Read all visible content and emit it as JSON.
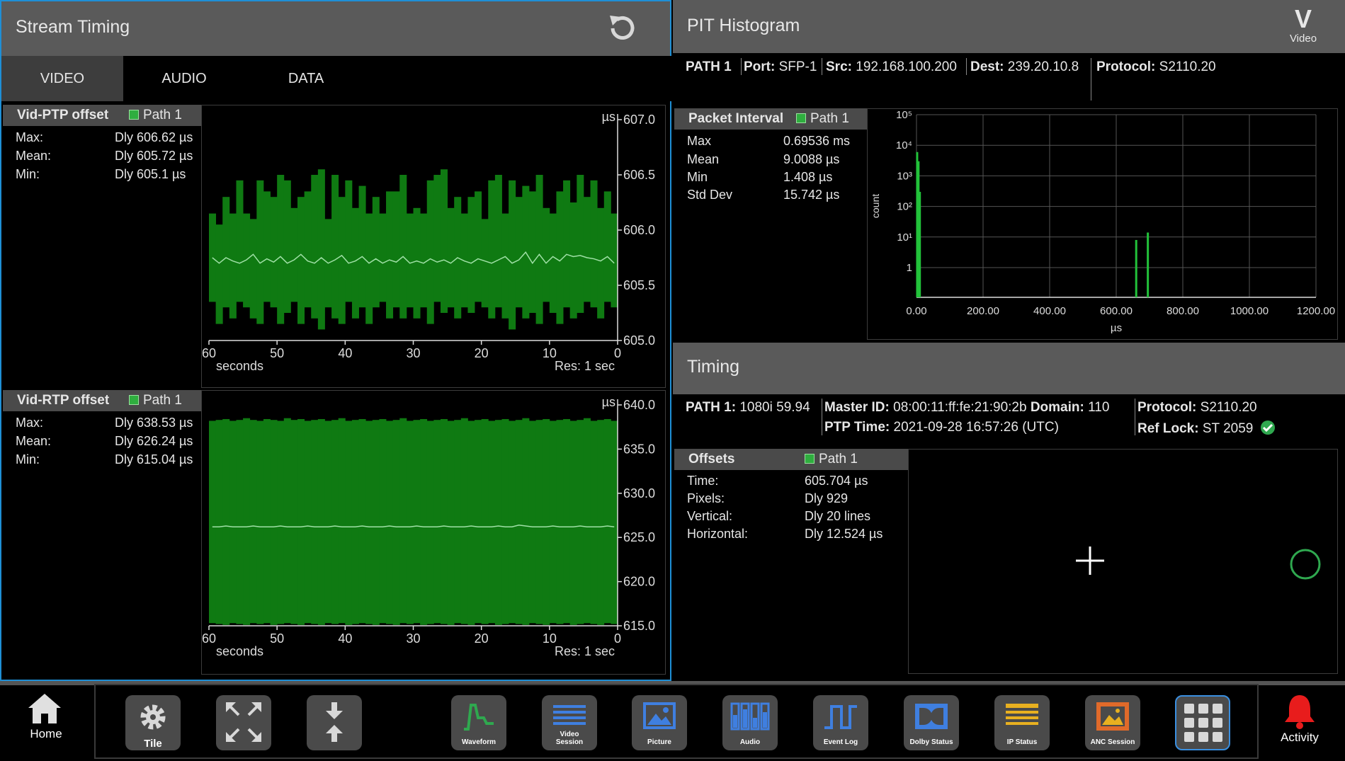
{
  "stream_timing": {
    "title": "Stream Timing",
    "tabs": [
      {
        "label": "VIDEO",
        "active": true
      },
      {
        "label": "AUDIO",
        "active": false
      },
      {
        "label": "DATA",
        "active": false
      }
    ],
    "ptp": {
      "title": "Vid-PTP offset",
      "path": "Path 1",
      "stats": [
        {
          "k": "Max:",
          "v": "Dly 606.62 µs"
        },
        {
          "k": "Mean:",
          "v": "Dly 605.72 µs"
        },
        {
          "k": "Min:",
          "v": "Dly 605.1 µs"
        }
      ]
    },
    "rtp": {
      "title": "Vid-RTP offset",
      "path": "Path 1",
      "stats": [
        {
          "k": "Max:",
          "v": "Dly 638.53 µs"
        },
        {
          "k": "Mean:",
          "v": "Dly 626.24 µs"
        },
        {
          "k": "Min:",
          "v": "Dly 615.04 µs"
        }
      ]
    }
  },
  "pit": {
    "title": "PIT Histogram",
    "mode_letter": "V",
    "mode_label": "Video",
    "info": [
      {
        "k": "PATH 1",
        "v": ""
      },
      {
        "k": "Port:",
        "v": "SFP-1"
      },
      {
        "k": "Src:",
        "v": "192.168.100.200"
      },
      {
        "k": "Dest:",
        "v": "239.20.10.8"
      },
      {
        "k": "Protocol:",
        "v": "S2110.20"
      }
    ],
    "packet_interval": {
      "title": "Packet Interval",
      "path": "Path 1",
      "stats": [
        {
          "k": "Max",
          "v": "0.69536 ms"
        },
        {
          "k": "Mean",
          "v": "9.0088 µs"
        },
        {
          "k": "Min",
          "v": "1.408 µs"
        },
        {
          "k": "Std Dev",
          "v": "15.742 µs"
        }
      ]
    }
  },
  "timing": {
    "title": "Timing",
    "path_label": "PATH 1:",
    "path_value": "1080i 59.94",
    "master_id_label": "Master ID:",
    "master_id": "08:00:11:ff:fe:21:90:2b",
    "domain_label": "Domain:",
    "domain": "110",
    "ptp_time_label": "PTP Time:",
    "ptp_time": "2021-09-28 16:57:26 (UTC)",
    "protocol_label": "Protocol:",
    "protocol": "S2110.20",
    "ref_lock_label": "Ref Lock:",
    "ref_lock": "ST 2059",
    "offsets": {
      "title": "Offsets",
      "path": "Path 1",
      "stats": [
        {
          "k": "Time:",
          "v": "605.704 µs"
        },
        {
          "k": "Pixels:",
          "v": "Dly 929"
        },
        {
          "k": "Vertical:",
          "v": "Dly 20 lines"
        },
        {
          "k": "Horizontal:",
          "v": "Dly 12.524 µs"
        }
      ]
    }
  },
  "chart_data": [
    {
      "type": "area",
      "name": "Vid-PTP offset",
      "xlabel": "seconds",
      "note": "Res: 1 sec",
      "ylabel": "µs",
      "xlim": [
        60,
        0
      ],
      "ylim": [
        605.0,
        607.0
      ],
      "x_ticks": [
        "60",
        "50",
        "40",
        "30",
        "20",
        "10",
        "0"
      ],
      "y_ticks": [
        "607.0",
        "606.5",
        "606.0",
        "605.5",
        "605.0"
      ],
      "max": [
        606.15,
        606.05,
        606.3,
        606.15,
        606.45,
        606.15,
        606.1,
        606.45,
        606.35,
        606.3,
        606.5,
        606.45,
        606.2,
        606.3,
        606.35,
        606.5,
        606.55,
        606.1,
        606.5,
        606.3,
        606.45,
        606.2,
        606.4,
        606.15,
        606.3,
        606.15,
        606.35,
        606.35,
        606.5,
        606.15,
        606.2,
        606.15,
        606.45,
        606.5,
        606.55,
        606.2,
        606.3,
        606.15,
        606.3,
        606.35,
        606.1,
        606.45,
        606.5,
        606.15,
        606.45,
        606.3,
        606.4,
        606.35,
        606.5,
        606.2,
        606.15,
        606.35,
        606.45,
        606.25,
        606.5,
        606.3,
        606.45,
        606.2,
        606.35,
        606.15
      ],
      "min": [
        605.35,
        605.15,
        605.3,
        605.2,
        605.35,
        605.3,
        605.2,
        605.15,
        605.35,
        605.3,
        605.15,
        605.25,
        605.35,
        605.15,
        605.3,
        605.2,
        605.1,
        605.3,
        605.2,
        605.15,
        605.35,
        605.2,
        605.3,
        605.15,
        605.3,
        605.35,
        605.2,
        605.3,
        605.2,
        605.3,
        605.2,
        605.3,
        605.15,
        605.35,
        605.25,
        605.3,
        605.2,
        605.3,
        605.25,
        605.35,
        605.3,
        605.2,
        605.3,
        605.2,
        605.1,
        605.3,
        605.2,
        605.25,
        605.15,
        605.35,
        605.25,
        605.15,
        605.3,
        605.2,
        605.25,
        605.35,
        605.3,
        605.2,
        605.35,
        605.3
      ],
      "mean": [
        605.75,
        605.7,
        605.75,
        605.72,
        605.7,
        605.73,
        605.78,
        605.7,
        605.74,
        605.71,
        605.76,
        605.7,
        605.73,
        605.78,
        605.72,
        605.7,
        605.75,
        605.7,
        605.73,
        605.77,
        605.7,
        605.72,
        605.76,
        605.7,
        605.74,
        605.7,
        605.73,
        605.71,
        605.76,
        605.7,
        605.72,
        605.7,
        605.74,
        605.71,
        605.73,
        605.7,
        605.75,
        605.72,
        605.7,
        605.74,
        605.72,
        605.7,
        605.73,
        605.76,
        605.7,
        605.73,
        605.8,
        605.7,
        605.78,
        605.7,
        605.76,
        605.72,
        605.78,
        605.76,
        605.77,
        605.75,
        605.74,
        605.72,
        605.76,
        605.7
      ]
    },
    {
      "type": "area",
      "name": "Vid-RTP offset",
      "xlabel": "seconds",
      "note": "Res: 1 sec",
      "ylabel": "µs",
      "xlim": [
        60,
        0
      ],
      "ylim": [
        615.0,
        640.0
      ],
      "x_ticks": [
        "60",
        "50",
        "40",
        "30",
        "20",
        "10",
        "0"
      ],
      "y_ticks": [
        "640.0",
        "635.0",
        "630.0",
        "625.0",
        "620.0",
        "615.0"
      ],
      "max": [
        638.2,
        638.3,
        638.4,
        638.2,
        638.3,
        638.5,
        638.3,
        638.2,
        638.4,
        638.3,
        638.2,
        638.5,
        638.3,
        638.4,
        638.2,
        638.3,
        638.4,
        638.2,
        638.3,
        638.5,
        638.2,
        638.3,
        638.4,
        638.2,
        638.3,
        638.4,
        638.2,
        638.3,
        638.5,
        638.2,
        638.3,
        638.4,
        638.2,
        638.3,
        638.4,
        638.2,
        638.3,
        638.5,
        638.2,
        638.3,
        638.4,
        638.2,
        638.3,
        638.4,
        638.2,
        638.3,
        638.5,
        638.2,
        638.3,
        638.4,
        638.2,
        638.3,
        638.4,
        638.2,
        638.3,
        638.5,
        638.2,
        638.3,
        638.4,
        638.2
      ],
      "min": [
        615.3,
        615.2,
        615.1,
        615.3,
        615.2,
        615.1,
        615.3,
        615.2,
        615.3,
        615.1,
        615.2,
        615.3,
        615.2,
        615.1,
        615.3,
        615.2,
        615.1,
        615.3,
        615.2,
        615.3,
        615.1,
        615.2,
        615.3,
        615.2,
        615.1,
        615.3,
        615.2,
        615.1,
        615.3,
        615.2,
        615.3,
        615.1,
        615.2,
        615.3,
        615.2,
        615.1,
        615.3,
        615.2,
        615.1,
        615.3,
        615.2,
        615.3,
        615.1,
        615.2,
        615.3,
        615.2,
        615.1,
        615.3,
        615.2,
        615.1,
        615.3,
        615.2,
        615.3,
        615.1,
        615.2,
        615.3,
        615.2,
        615.1,
        615.3,
        615.2
      ],
      "mean": [
        626.2,
        626.2,
        626.3,
        626.2,
        626.2,
        626.2,
        626.3,
        626.2,
        626.2,
        626.2,
        626.3,
        626.2,
        626.2,
        626.2,
        626.3,
        626.2,
        626.2,
        626.2,
        626.3,
        626.2,
        626.2,
        626.2,
        626.3,
        626.2,
        626.2,
        626.2,
        626.3,
        626.2,
        626.2,
        626.2,
        626.3,
        626.2,
        626.2,
        626.2,
        626.3,
        626.2,
        626.2,
        626.2,
        626.3,
        626.2,
        626.2,
        626.2,
        626.3,
        626.2,
        626.2,
        626.4,
        626.3,
        626.2,
        626.2,
        626.2,
        626.3,
        626.2,
        626.2,
        626.2,
        626.3,
        626.2,
        626.2,
        626.2,
        626.3,
        626.2
      ]
    },
    {
      "type": "bar",
      "name": "PIT Histogram",
      "xlabel": "µs",
      "ylabel": "count",
      "yscale": "log",
      "xlim": [
        0,
        1200
      ],
      "x_ticks": [
        "0.00",
        "200.00",
        "400.00",
        "600.00",
        "800.00",
        "1000.00",
        "1200.00"
      ],
      "y_ticks": [
        "10⁵",
        "10⁴",
        "10³",
        "10²",
        "10¹",
        "1"
      ],
      "bins": [
        {
          "x": 2,
          "count": 6000
        },
        {
          "x": 6,
          "count": 3000
        },
        {
          "x": 10,
          "count": 300
        },
        {
          "x": 660,
          "count": 8
        },
        {
          "x": 695,
          "count": 14
        }
      ]
    }
  ],
  "dock": {
    "home": "Home",
    "activity": "Activity",
    "buttons": [
      {
        "id": "tile",
        "label": "Tile"
      },
      {
        "id": "fullscreen",
        "label": ""
      },
      {
        "id": "split",
        "label": ""
      },
      {
        "id": "waveform",
        "label": "Waveform"
      },
      {
        "id": "video-session",
        "label": "Video Session"
      },
      {
        "id": "picture",
        "label": "Picture"
      },
      {
        "id": "audio",
        "label": "Audio"
      },
      {
        "id": "event-log",
        "label": "Event Log"
      },
      {
        "id": "dolby-status",
        "label": "Dolby Status"
      },
      {
        "id": "ip-status",
        "label": "IP Status"
      },
      {
        "id": "anc-session",
        "label": "ANC Session"
      },
      {
        "id": "apps",
        "label": ""
      }
    ],
    "colors": {
      "green": "#2fa84f",
      "blue": "#3f7fe0",
      "yellow": "#e8b020",
      "orange": "#e06a2a",
      "alert": "#e81c1c"
    }
  }
}
